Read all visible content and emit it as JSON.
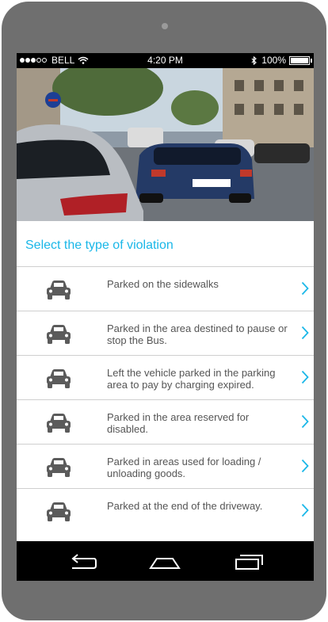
{
  "status_bar": {
    "carrier": "BELL",
    "time": "4:20 PM",
    "battery": "100%"
  },
  "header": {
    "title": "Select the type of violation"
  },
  "violations": [
    {
      "label": "Parked on the sidewalks",
      "icon": "car-icon"
    },
    {
      "label": "Parked in the area destined to pause or stop the Bus.",
      "icon": "car-icon"
    },
    {
      "label": "Left the vehicle parked in the parking area to pay by charging expired.",
      "icon": "car-icon"
    },
    {
      "label": "Parked in the area reserved for disabled.",
      "icon": "car-icon"
    },
    {
      "label": "Parked in areas used for loading / unloading goods.",
      "icon": "car-icon"
    },
    {
      "label": "Parked at the end of the driveway.",
      "icon": "car-icon"
    }
  ],
  "colors": {
    "accent": "#1ab7e8",
    "phone_body": "#6f6f6f",
    "icon": "#5b5b5b"
  }
}
